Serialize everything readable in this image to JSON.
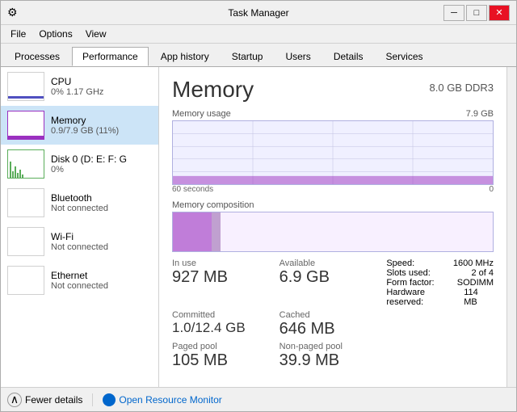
{
  "window": {
    "title": "Task Manager",
    "icon": "⚙"
  },
  "menu": {
    "items": [
      "File",
      "Options",
      "View"
    ]
  },
  "tabs": [
    {
      "label": "Processes",
      "active": false
    },
    {
      "label": "Performance",
      "active": true
    },
    {
      "label": "App history",
      "active": false
    },
    {
      "label": "Startup",
      "active": false
    },
    {
      "label": "Users",
      "active": false
    },
    {
      "label": "Details",
      "active": false
    },
    {
      "label": "Services",
      "active": false
    }
  ],
  "sidebar": {
    "items": [
      {
        "name": "CPU",
        "value": "0% 1.17 GHz",
        "type": "cpu"
      },
      {
        "name": "Memory",
        "value": "0.9/7.9 GB (11%)",
        "type": "memory"
      },
      {
        "name": "Disk 0 (D: E: F: G",
        "value": "0%",
        "type": "disk"
      },
      {
        "name": "Bluetooth",
        "value": "Not connected",
        "type": "bluetooth"
      },
      {
        "name": "Wi-Fi",
        "value": "Not connected",
        "type": "wifi"
      },
      {
        "name": "Ethernet",
        "value": "Not connected",
        "type": "ethernet"
      }
    ]
  },
  "main": {
    "title": "Memory",
    "subtitle": "8.0 GB DDR3",
    "chart": {
      "usage_label": "Memory usage",
      "max_value": "7.9 GB",
      "time_label": "60 seconds",
      "time_right": "0"
    },
    "composition_label": "Memory composition",
    "stats": {
      "in_use_label": "In use",
      "in_use_value": "927 MB",
      "available_label": "Available",
      "available_value": "6.9 GB",
      "committed_label": "Committed",
      "committed_value": "1.0/12.4 GB",
      "cached_label": "Cached",
      "cached_value": "646 MB",
      "paged_label": "Paged pool",
      "paged_value": "105 MB",
      "nonpaged_label": "Non-paged pool",
      "nonpaged_value": "39.9 MB",
      "speed_label": "Speed:",
      "speed_value": "1600 MHz",
      "slots_label": "Slots used:",
      "slots_value": "2 of 4",
      "form_label": "Form factor:",
      "form_value": "SODIMM",
      "hardware_label": "Hardware reserved:",
      "hardware_value": "114 MB"
    }
  },
  "bottom": {
    "fewer_details": "Fewer details",
    "open_resource": "Open Resource Monitor"
  },
  "icons": {
    "chevron_up": "⌃",
    "resource_monitor": "🔵"
  }
}
